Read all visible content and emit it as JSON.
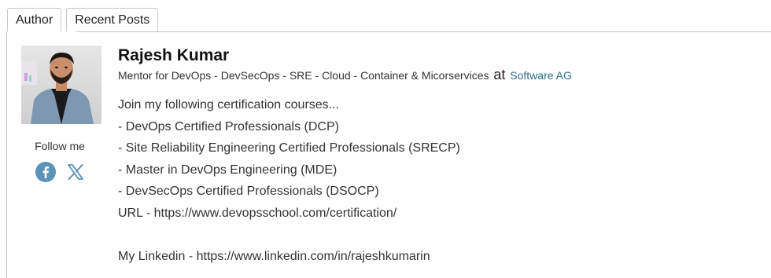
{
  "tabs": [
    {
      "label": "Author"
    },
    {
      "label": "Recent Posts"
    }
  ],
  "author": {
    "name": "Rajesh Kumar",
    "tagline": "Mentor for DevOps - DevSecOps - SRE - Cloud - Container & Micorservices",
    "at": "at",
    "company": "Software AG",
    "follow_label": "Follow me",
    "social": [
      "facebook-icon",
      "x-icon"
    ],
    "bio": {
      "line1": "Join my following certification courses...",
      "line2": "- DevOps Certified Professionals (DCP)",
      "line3": "- Site Reliability Engineering Certified Professionals (SRECP)",
      "line4": "- Master in DevOps Engineering (MDE)",
      "line5": "- DevSecOps Certified Professionals (DSOCP)",
      "line6": "URL - https://www.devopsschool.com/certification/",
      "line7": "My Linkedin - https://www.linkedin.com/in/rajeshkumarin"
    }
  },
  "colors": {
    "link": "#2f6f8f",
    "icon": "#5a93b5",
    "border": "#c8c8c8"
  }
}
